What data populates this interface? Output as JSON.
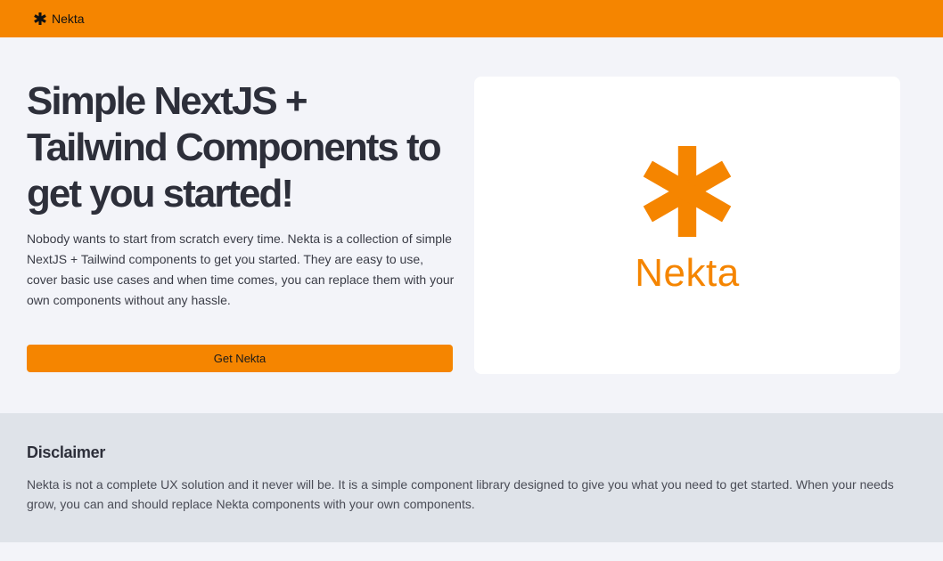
{
  "nav": {
    "brand_label": "Nekta",
    "brand_icon": "asterisk-icon"
  },
  "hero": {
    "headline": "Simple NextJS + Tailwind Components to get you started!",
    "intro": "Nobody wants to start from scratch every time. Nekta is a collection of simple NextJS + Tailwind components to get you started. They are easy to use, cover basic use cases and when time comes, you can replace them with your own components without any hassle.",
    "cta_label": "Get Nekta",
    "logo_text": "Nekta",
    "logo_icon": "asterisk-icon"
  },
  "disclaimer": {
    "title": "Disclaimer",
    "body": "Nekta is not a complete UX solution and it never will be. It is a simple component library designed to give you what you need to get started. When your needs grow, you can and should replace Nekta components with your own components."
  },
  "colors": {
    "accent": "#f58500",
    "page_background": "#f3f4f9",
    "disclaimer_background": "#dfe3e9",
    "heading_text": "#2d2f3a"
  }
}
